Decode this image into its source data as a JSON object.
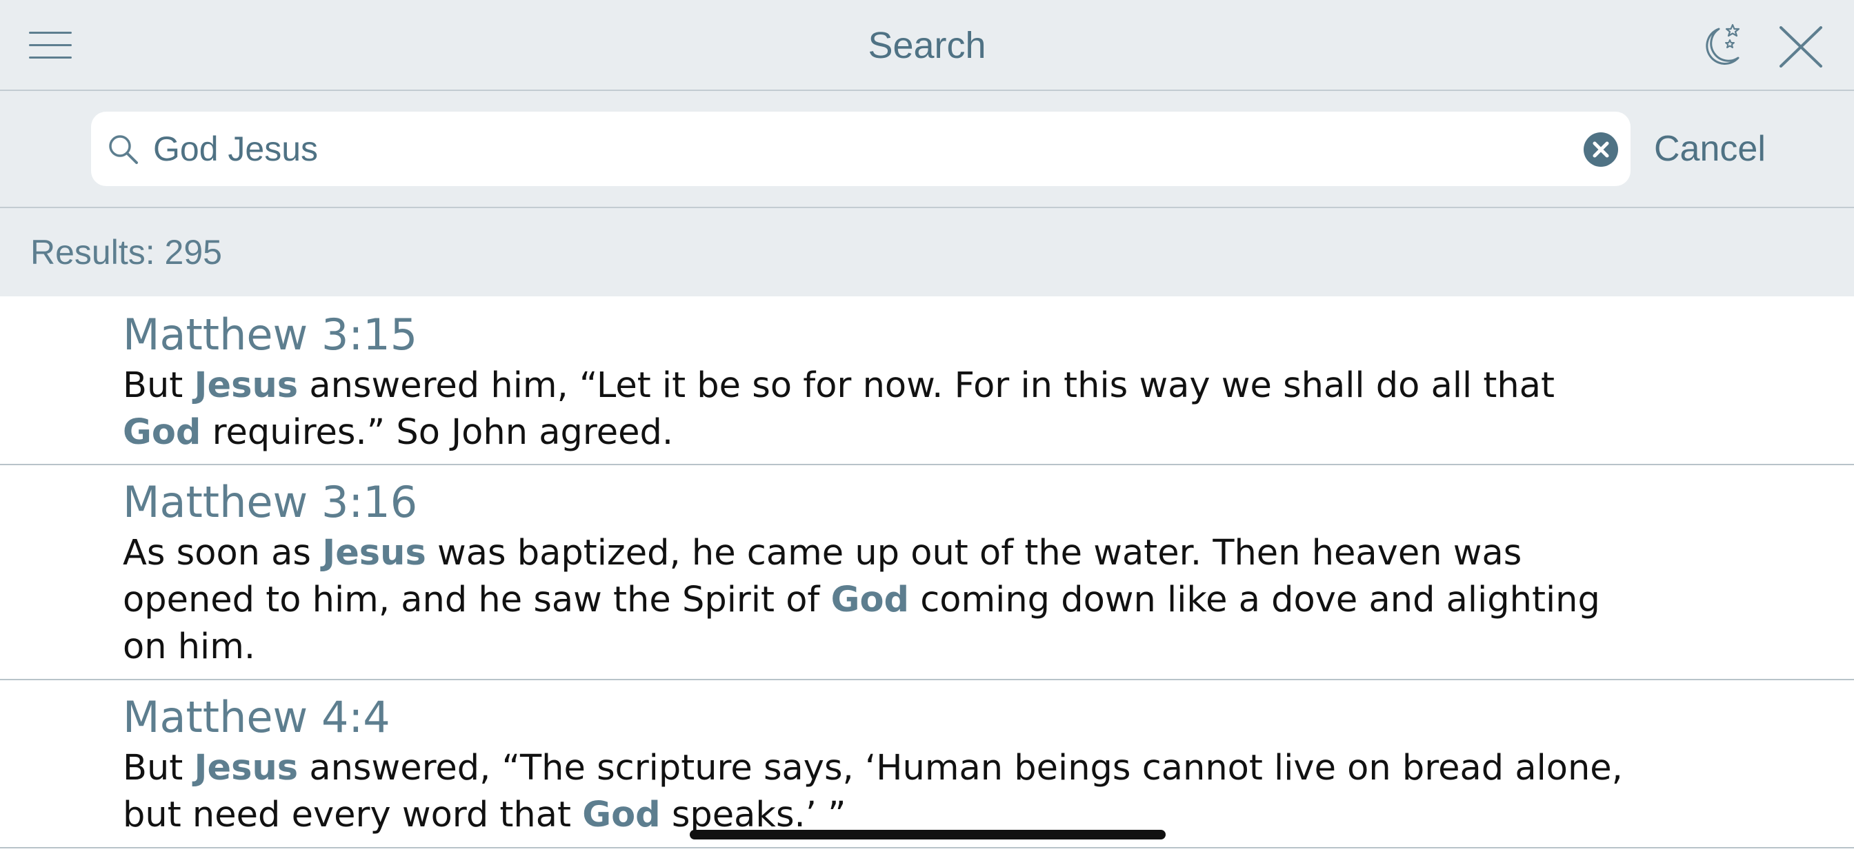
{
  "header": {
    "title": "Search",
    "icons": {
      "menu": "hamburger-menu-icon",
      "night_mode": "moon-stars-icon",
      "close": "close-icon"
    }
  },
  "search": {
    "value": "God Jesus",
    "cancel_label": "Cancel"
  },
  "results": {
    "count_label": "Results: 295",
    "items": [
      {
        "reference": "Matthew 3:15",
        "lines": [
          [
            {
              "text": "But ",
              "hl": false
            },
            {
              "text": "Jesus",
              "hl": true
            },
            {
              "text": " answered him, “Let it be so for now. For in this way we shall do all that",
              "hl": false
            }
          ],
          [
            {
              "text": "God",
              "hl": true
            },
            {
              "text": " requires.” So John agreed.",
              "hl": false
            }
          ]
        ]
      },
      {
        "reference": "Matthew 3:16",
        "lines": [
          [
            {
              "text": "As soon as ",
              "hl": false
            },
            {
              "text": "Jesus",
              "hl": true
            },
            {
              "text": " was baptized, he came up out of the water. Then heaven was",
              "hl": false
            }
          ],
          [
            {
              "text": "opened to him, and he saw the Spirit of ",
              "hl": false
            },
            {
              "text": "God",
              "hl": true
            },
            {
              "text": " coming down like a dove and alighting",
              "hl": false
            }
          ],
          [
            {
              "text": "on him.",
              "hl": false
            }
          ]
        ]
      },
      {
        "reference": "Matthew 4:4",
        "lines": [
          [
            {
              "text": "But ",
              "hl": false
            },
            {
              "text": "Jesus",
              "hl": true
            },
            {
              "text": " answered, “The scripture says, ‘Human beings cannot live on bread alone,",
              "hl": false
            }
          ],
          [
            {
              "text": "but need every word that ",
              "hl": false
            },
            {
              "text": "God",
              "hl": true
            },
            {
              "text": " speaks.’ ”",
              "hl": false
            }
          ]
        ]
      }
    ]
  },
  "colors": {
    "accent": "#5d7e8f",
    "header_bg": "#e9edf0",
    "text": "#111111"
  }
}
